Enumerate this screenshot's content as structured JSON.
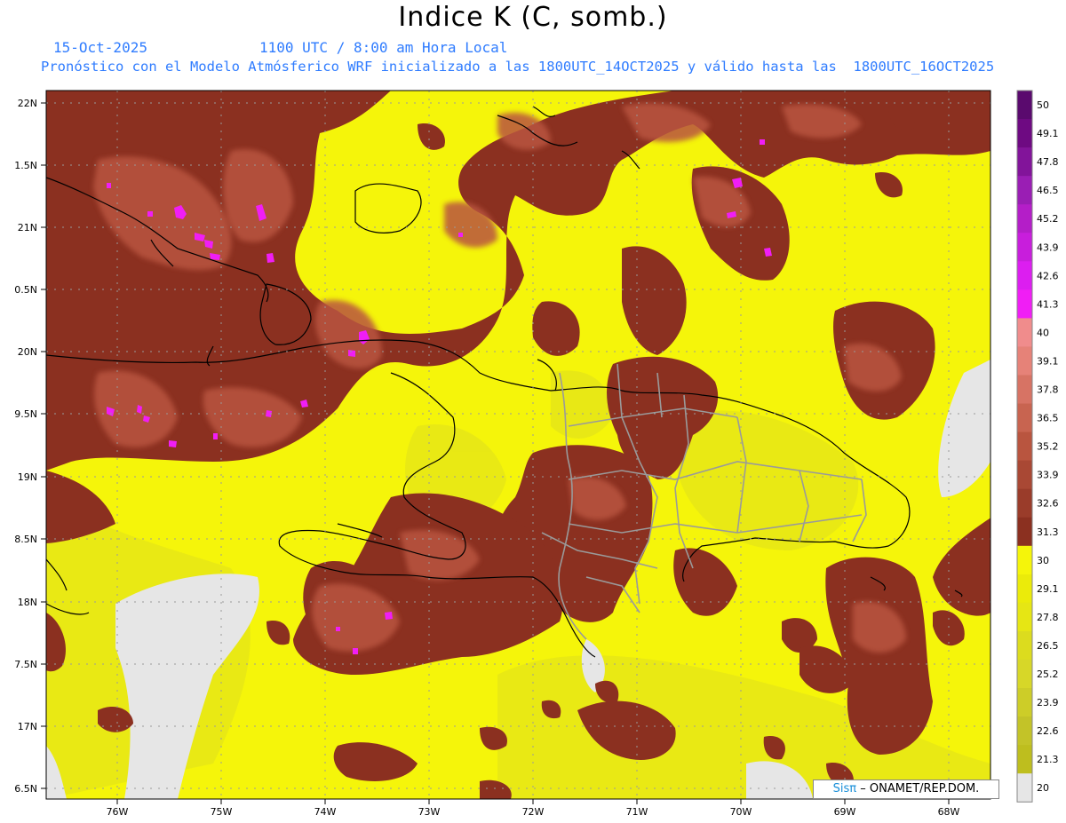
{
  "header": {
    "title": "Indice K (C, somb.)",
    "date": "15-Oct-2025",
    "time": "1100 UTC / 8:00 am Hora Local",
    "subtitle": "Pronóstico con el Modelo Atmósferico WRF inicializado a las 1800UTC_14OCT2025 y válido hasta las  1800UTC_16OCT2025"
  },
  "map": {
    "lat_labels": [
      "22N",
      "1.5N",
      "21N",
      "0.5N",
      "20N",
      "9.5N",
      "19N",
      "8.5N",
      "18N",
      "7.5N",
      "17N",
      "6.5N"
    ],
    "lon_labels": [
      "76W",
      "75W",
      "74W",
      "73W",
      "72W",
      "71W",
      "70W",
      "69W",
      "68W"
    ],
    "grid": "dotted"
  },
  "colorbar": {
    "labels": [
      "50",
      "49.1",
      "47.8",
      "46.5",
      "45.2",
      "43.9",
      "42.6",
      "41.3",
      "40",
      "39.1",
      "37.8",
      "36.5",
      "35.2",
      "33.9",
      "32.6",
      "31.3",
      "30",
      "29.1",
      "27.8",
      "26.5",
      "25.2",
      "23.9",
      "22.6",
      "21.3",
      "20"
    ],
    "colors": [
      "#5a0a6e",
      "#6e0a82",
      "#82149a",
      "#9a1eb4",
      "#b41ec8",
      "#c81edc",
      "#dc1ef0",
      "#f01ef5",
      "#f08c8c",
      "#e68278",
      "#d77364",
      "#c86450",
      "#b9553f",
      "#a94834",
      "#9a3c2a",
      "#8b3020",
      "#f5f50a",
      "#ebeb0a",
      "#e6e614",
      "#dcdc1e",
      "#d7d728",
      "#cdcd28",
      "#c3c328",
      "#bebe1e",
      "#e6e6e6"
    ]
  },
  "colors": {
    "dry": "#f5f50a",
    "moist": "#8b3020",
    "land_none": "#e6e6e6"
  },
  "credit": {
    "logo": "Sisπ",
    "text": "– ONAMET/REP.DOM."
  }
}
